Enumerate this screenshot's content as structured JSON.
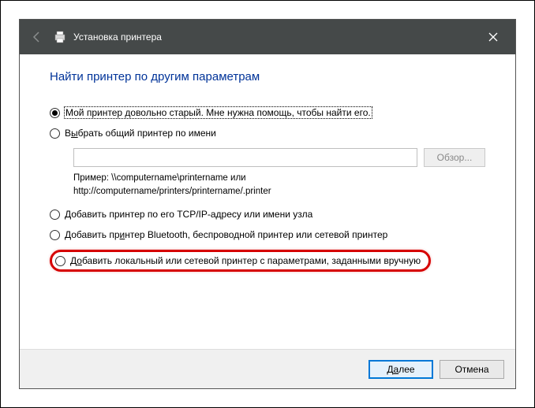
{
  "titlebar": {
    "title": "Установка принтера"
  },
  "page": {
    "heading": "Найти принтер по другим параметрам"
  },
  "options": {
    "old_printer": "Мой принтер довольно старый. Мне нужна помощь, чтобы найти его.",
    "shared_prefix": "В",
    "shared_key": "ы",
    "shared_suffix": "брать общий принтер по имени",
    "browse_label": "Обзор...",
    "example_line1": "Пример: \\\\computername\\printername или",
    "example_line2": "http://computername/printers/printername/.printer",
    "tcpip": "Добавить принтер по его TCP/IP-адресу или имени узла",
    "bluetooth_prefix": "Добавить пр",
    "bluetooth_key": "и",
    "bluetooth_suffix": "нтер Bluetooth, беспроводной принтер или сетевой принтер",
    "local_prefix": "Д",
    "local_key": "о",
    "local_suffix": "бавить локальный или сетевой принтер с параметрами, заданными вручную"
  },
  "footer": {
    "next_prefix": "Д",
    "next_key": "а",
    "next_suffix": "лее",
    "cancel": "Отмена"
  }
}
